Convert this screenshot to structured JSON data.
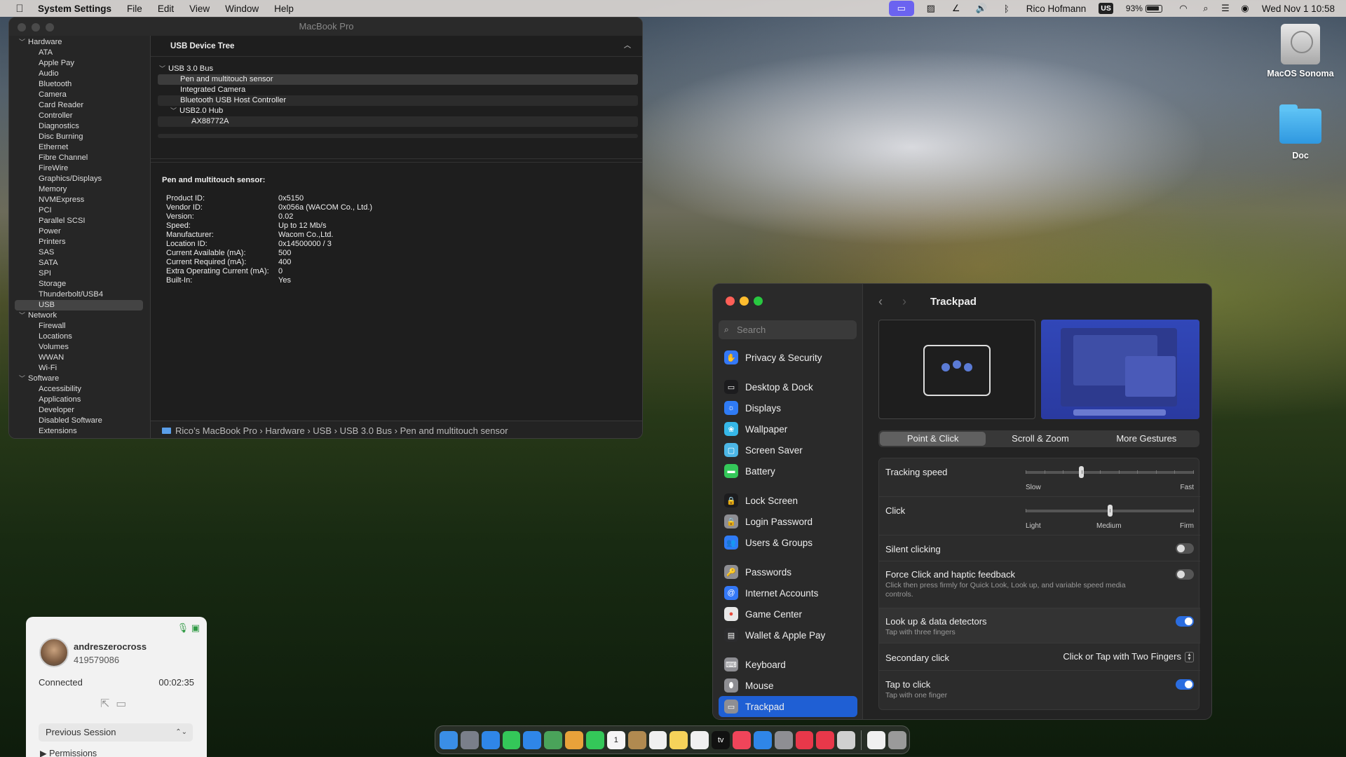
{
  "menubar": {
    "app": "System Settings",
    "menus": [
      "File",
      "Edit",
      "View",
      "Window",
      "Help"
    ],
    "user": "Rico Hofmann",
    "input_source": "US",
    "battery": "93%",
    "datetime": "Wed Nov 1  10:58",
    "icons": [
      "apple-icon",
      "screen-mirroring-icon",
      "activity-monitor-icon",
      "pen-icon",
      "volume-icon",
      "bluetooth-icon",
      "battery-icon",
      "wifi-icon",
      "spotlight-icon",
      "control-center-icon",
      "siri-icon"
    ]
  },
  "sysinfo": {
    "title": "MacBook Pro",
    "sidebar": {
      "hardware": "Hardware",
      "hardware_items": [
        "ATA",
        "Apple Pay",
        "Audio",
        "Bluetooth",
        "Camera",
        "Card Reader",
        "Controller",
        "Diagnostics",
        "Disc Burning",
        "Ethernet",
        "Fibre Channel",
        "FireWire",
        "Graphics/Displays",
        "Memory",
        "NVMExpress",
        "PCI",
        "Parallel SCSI",
        "Power",
        "Printers",
        "SAS",
        "SATA",
        "SPI",
        "Storage",
        "Thunderbolt/USB4",
        "USB"
      ],
      "network": "Network",
      "network_items": [
        "Firewall",
        "Locations",
        "Volumes",
        "WWAN",
        "Wi-Fi"
      ],
      "software": "Software",
      "software_items": [
        "Accessibility",
        "Applications",
        "Developer",
        "Disabled Software",
        "Extensions"
      ],
      "selected": "USB"
    },
    "tree_header": "USB Device Tree",
    "tree": {
      "bus": "USB 3.0 Bus",
      "items": [
        "Pen and multitouch sensor",
        "Integrated Camera",
        "Bluetooth USB Host Controller"
      ],
      "hub": "USB2.0 Hub",
      "hub_items": [
        "AX88772A"
      ]
    },
    "detail": {
      "heading": "Pen and multitouch sensor:",
      "rows": [
        {
          "k": "Product ID:",
          "v": "0x5150"
        },
        {
          "k": "Vendor ID:",
          "v": "0x056a  (WACOM Co., Ltd.)"
        },
        {
          "k": "Version:",
          "v": "0.02"
        },
        {
          "k": "Speed:",
          "v": "Up to 12 Mb/s"
        },
        {
          "k": "Manufacturer:",
          "v": "Wacom Co.,Ltd."
        },
        {
          "k": "Location ID:",
          "v": "0x14500000 / 3"
        },
        {
          "k": "Current Available (mA):",
          "v": "500"
        },
        {
          "k": "Current Required (mA):",
          "v": "400"
        },
        {
          "k": "Extra Operating Current (mA):",
          "v": "0"
        },
        {
          "k": "Built-In:",
          "v": "Yes"
        }
      ]
    },
    "path": [
      "Rico’s MacBook Pro",
      "Hardware",
      "USB",
      "USB 3.0 Bus",
      "Pen and multitouch sensor"
    ],
    "path_sep": "›"
  },
  "desktop": {
    "icons": [
      {
        "label": "MacOS Sonoma",
        "icon": "hard-drive-icon"
      },
      {
        "label": "Doc",
        "icon": "folder-icon"
      }
    ]
  },
  "settings": {
    "search_placeholder": "Search",
    "nav": [
      {
        "label": "Privacy & Security",
        "color": "#3478f6",
        "glyph": "✋"
      },
      {
        "label": "Desktop & Dock",
        "color": "#1c1c1e",
        "glyph": "▭"
      },
      {
        "label": "Displays",
        "color": "#2f7bf5",
        "glyph": "☼"
      },
      {
        "label": "Wallpaper",
        "color": "#36b7e8",
        "glyph": "❀"
      },
      {
        "label": "Screen Saver",
        "color": "#4cb6e6",
        "glyph": "▢"
      },
      {
        "label": "Battery",
        "color": "#34c759",
        "glyph": "▬"
      },
      {
        "label": "Lock Screen",
        "color": "#1c1c1e",
        "glyph": "🔒"
      },
      {
        "label": "Login Password",
        "color": "#8e8e93",
        "glyph": "🔒"
      },
      {
        "label": "Users & Groups",
        "color": "#2f7bf5",
        "glyph": "👥"
      },
      {
        "label": "Passwords",
        "color": "#8e8e93",
        "glyph": "🔑"
      },
      {
        "label": "Internet Accounts",
        "color": "#3478f6",
        "glyph": "@"
      },
      {
        "label": "Game Center",
        "color": "#e8e8e8",
        "glyph": "●"
      },
      {
        "label": "Wallet & Apple Pay",
        "color": "#2c2c2e",
        "glyph": "▤"
      },
      {
        "label": "Keyboard",
        "color": "#8e8e93",
        "glyph": "⌨"
      },
      {
        "label": "Mouse",
        "color": "#8e8e93",
        "glyph": "⬮"
      },
      {
        "label": "Trackpad",
        "color": "#8e8e93",
        "glyph": "▭"
      }
    ],
    "selected": "Trackpad",
    "title": "Trackpad",
    "tabs": [
      "Point & Click",
      "Scroll & Zoom",
      "More Gestures"
    ],
    "active_tab": "Point & Click",
    "tracking_speed": {
      "label": "Tracking speed",
      "min": "Slow",
      "max": "Fast",
      "value": 0.33
    },
    "click": {
      "label": "Click",
      "low": "Light",
      "mid": "Medium",
      "high": "Firm",
      "value": 0.5
    },
    "silent_clicking": {
      "label": "Silent clicking",
      "on": false
    },
    "force_click": {
      "label": "Force Click and haptic feedback",
      "desc": "Click then press firmly for Quick Look, Look up, and variable speed media controls.",
      "on": false
    },
    "lookup": {
      "label": "Look up & data detectors",
      "desc": "Tap with three fingers",
      "on": true
    },
    "secondary_click": {
      "label": "Secondary click",
      "value": "Click or Tap with Two Fingers"
    },
    "tap_to_click": {
      "label": "Tap to click",
      "desc": "Tap with one finger",
      "on": true
    }
  },
  "remote": {
    "name": "andreszerocross",
    "id": "419579086",
    "status": "Connected",
    "time": "00:02:35",
    "dropdown": "Previous Session",
    "permissions": "Permissions"
  },
  "dock": {
    "apps": [
      {
        "name": "finder",
        "color": "#3a8ee6"
      },
      {
        "name": "launchpad",
        "color": "#7a7f8a"
      },
      {
        "name": "safari",
        "color": "#2f86e8"
      },
      {
        "name": "messages",
        "color": "#34c759"
      },
      {
        "name": "mail",
        "color": "#2f86e8"
      },
      {
        "name": "maps",
        "color": "#4aa35a"
      },
      {
        "name": "photos",
        "color": "#e8a23a"
      },
      {
        "name": "facetime",
        "color": "#34c759"
      },
      {
        "name": "calendar",
        "color": "#f5f5f5"
      },
      {
        "name": "notes-brown",
        "color": "#b08a50"
      },
      {
        "name": "reminders",
        "color": "#f0f0f0"
      },
      {
        "name": "notes",
        "color": "#f6d35a"
      },
      {
        "name": "freeform",
        "color": "#f0f0f0"
      },
      {
        "name": "tv",
        "color": "#111111"
      },
      {
        "name": "music",
        "color": "#f0455a"
      },
      {
        "name": "app-store",
        "color": "#2f86e8"
      },
      {
        "name": "system-settings",
        "color": "#8e8e93"
      },
      {
        "name": "anydesk",
        "color": "#e8384a"
      },
      {
        "name": "anydesk-2",
        "color": "#e8384a"
      },
      {
        "name": "preview",
        "color": "#d0d0d0"
      },
      {
        "name": "document",
        "color": "#f0f0f0"
      },
      {
        "name": "trash",
        "color": "#9a9a9a"
      }
    ],
    "calendar_day": "1",
    "tv_label": "tv"
  }
}
